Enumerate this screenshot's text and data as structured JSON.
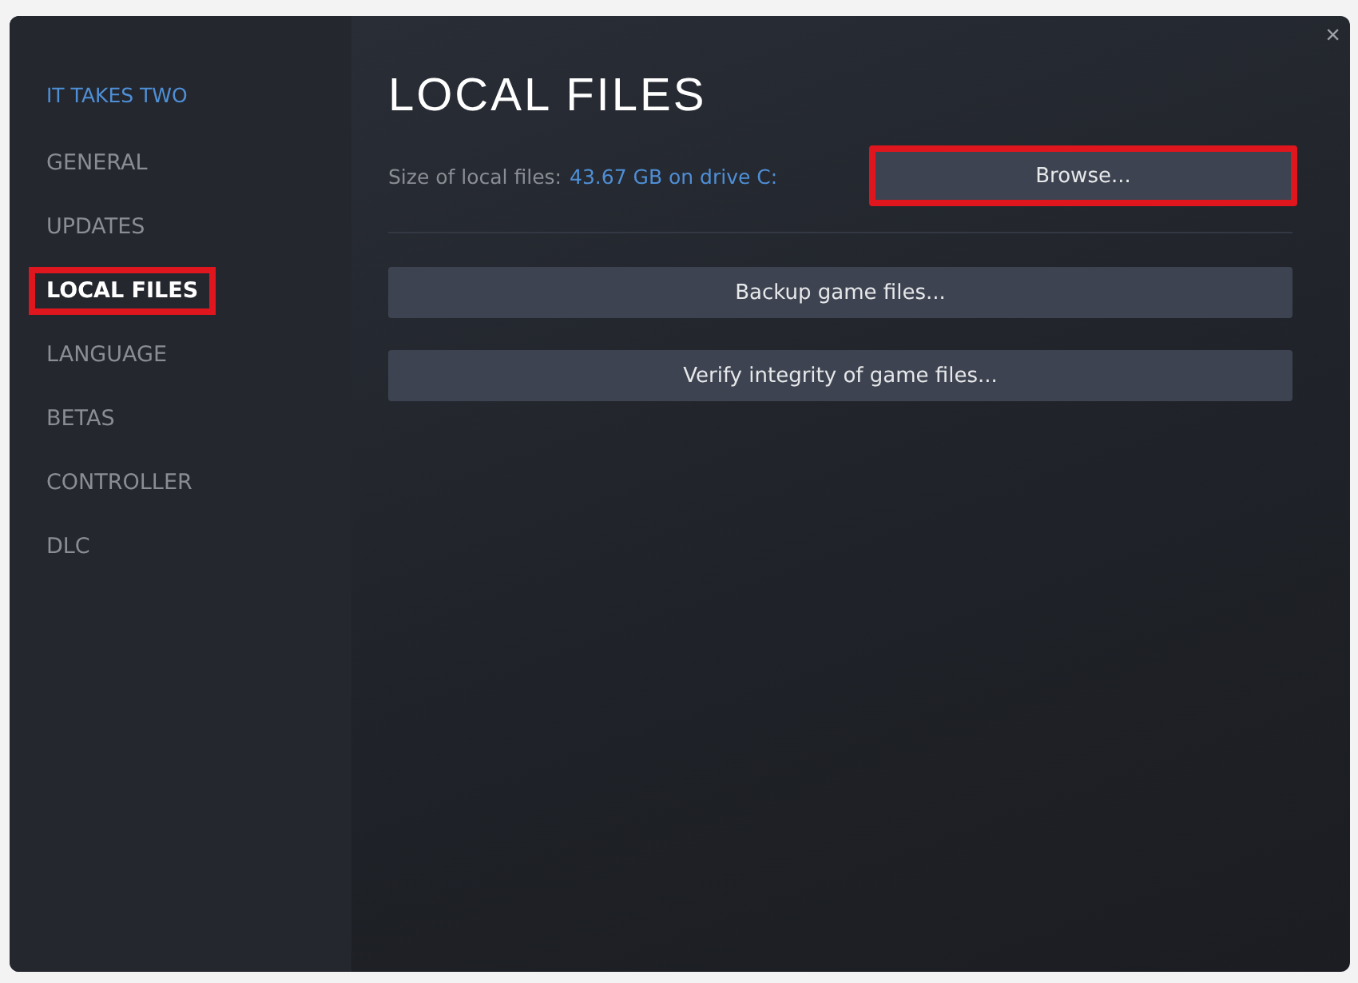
{
  "window": {
    "close": "×"
  },
  "sidebar": {
    "game_title": "IT TAKES TWO",
    "items": [
      {
        "label": "GENERAL",
        "selected": false,
        "highlighted": false
      },
      {
        "label": "UPDATES",
        "selected": false,
        "highlighted": false
      },
      {
        "label": "LOCAL FILES",
        "selected": true,
        "highlighted": true
      },
      {
        "label": "LANGUAGE",
        "selected": false,
        "highlighted": false
      },
      {
        "label": "BETAS",
        "selected": false,
        "highlighted": false
      },
      {
        "label": "CONTROLLER",
        "selected": false,
        "highlighted": false
      },
      {
        "label": "DLC",
        "selected": false,
        "highlighted": false
      }
    ]
  },
  "content": {
    "heading": "LOCAL FILES",
    "size_label": "Size of local files:",
    "size_value": "43.67 GB on drive C:",
    "browse_button": {
      "label": "Browse...",
      "highlighted": true
    },
    "buttons": [
      {
        "label": "Backup game files...",
        "highlighted": false
      },
      {
        "label": "Verify integrity of game files...",
        "highlighted": false
      }
    ]
  }
}
